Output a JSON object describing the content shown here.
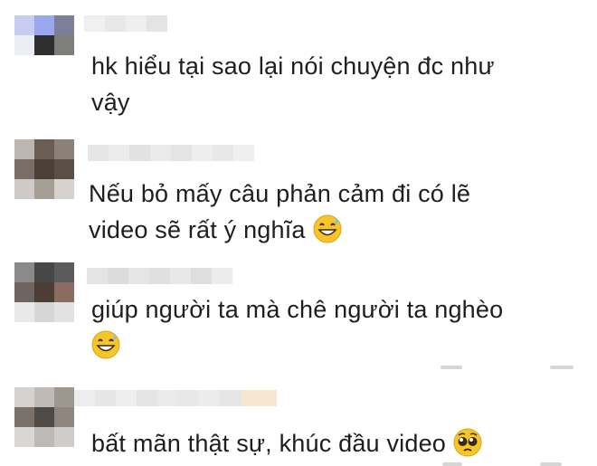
{
  "comments": [
    {
      "text_lines": [
        "hk hiểu tại sao lại nói chuyện đc như",
        "vậy"
      ]
    },
    {
      "text_lines": [
        "Nếu bỏ mấy câu phản cảm đi có lẽ",
        "video sẽ rất ý nghĩa"
      ],
      "emoji": "grinning-sweat-emoji"
    },
    {
      "text_lines": [
        "giúp người ta mà chê người ta nghèo",
        ""
      ],
      "emoji": "grinning-sweat-emoji"
    },
    {
      "text_lines": [
        "bất mãn thật sự, khúc đầu video"
      ],
      "emoji": "pleading-face-emoji"
    }
  ],
  "colors": {
    "text": "#1e1e1e",
    "background": "#ffffff",
    "emoji_yellow": "#f7c52a"
  }
}
